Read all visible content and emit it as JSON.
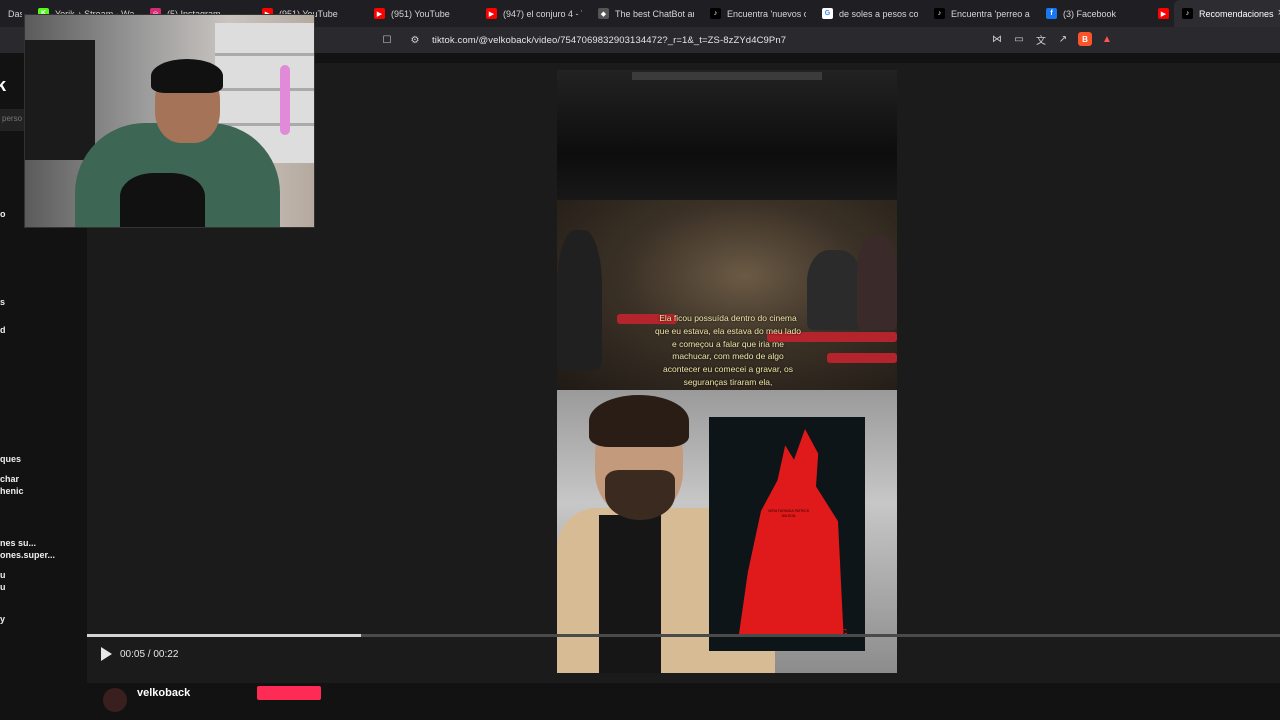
{
  "tabs": [
    {
      "title": "Dasl",
      "fav": "",
      "favColor": "#1f1f23"
    },
    {
      "title": "Yerik ♪ Stream - Watc",
      "fav": "K",
      "favColor": "#53fc18"
    },
    {
      "title": "(5) Instagram",
      "fav": "◎",
      "favColor": "#d62976"
    },
    {
      "title": "(951) YouTube",
      "fav": "▶",
      "favColor": "#ff0000"
    },
    {
      "title": "(951) YouTube",
      "fav": "▶",
      "favColor": "#ff0000"
    },
    {
      "title": "(947) el conjuro 4 - Yo",
      "fav": "▶",
      "favColor": "#ff0000"
    },
    {
      "title": "The best ChatBot and",
      "fav": "◆",
      "favColor": "#555555"
    },
    {
      "title": "Encuentra 'nuevos car",
      "fav": "♪",
      "favColor": "#000000"
    },
    {
      "title": "de soles a pesos colon",
      "fav": "G",
      "favColor": "#ffffff"
    },
    {
      "title": "Encuentra 'perreo al a",
      "fav": "♪",
      "favColor": "#000000"
    },
    {
      "title": "(3) Facebook",
      "fav": "f",
      "favColor": "#1877f2"
    },
    {
      "title": "",
      "fav": "▶",
      "favColor": "#ff0000"
    },
    {
      "title": "Recomendaciones",
      "fav": "♪",
      "favColor": "#000000",
      "active": true
    }
  ],
  "tab_close": "×",
  "address": {
    "url": "tiktok.com/@velkoback/video/7547069832903134472?_r=1&_t=ZS-8zZYd4C9Pn7"
  },
  "sidebar": {
    "logo_fragment": "k",
    "search_fragment": "perso",
    "fragments": [
      {
        "text": "o"
      },
      {
        "text": "s"
      },
      {
        "text": "d"
      },
      {
        "text": "ques"
      },
      {
        "text": "char"
      },
      {
        "text": "henic"
      },
      {
        "text": "nes su..."
      },
      {
        "text": "ones.super..."
      },
      {
        "text": "u"
      },
      {
        "text": "u"
      },
      {
        "text": "y"
      }
    ]
  },
  "video": {
    "caption": "Ela ficou possuída dentro do cinema que eu estava, ela estava do meu lado e começou a falar que iria me machucar, com medo de algo acontecer eu comecei a gravar, os seguranças tiraram ela,",
    "poster_title": "THE CONJURING",
    "poster_credits": "VERA FARMIGA PATRICK WILSON",
    "progress": 0.23
  },
  "controls": {
    "current_time": "00:05",
    "duration": "00:22",
    "time_display": "00:05 / 00:22"
  },
  "author": {
    "username": "velkoback"
  }
}
